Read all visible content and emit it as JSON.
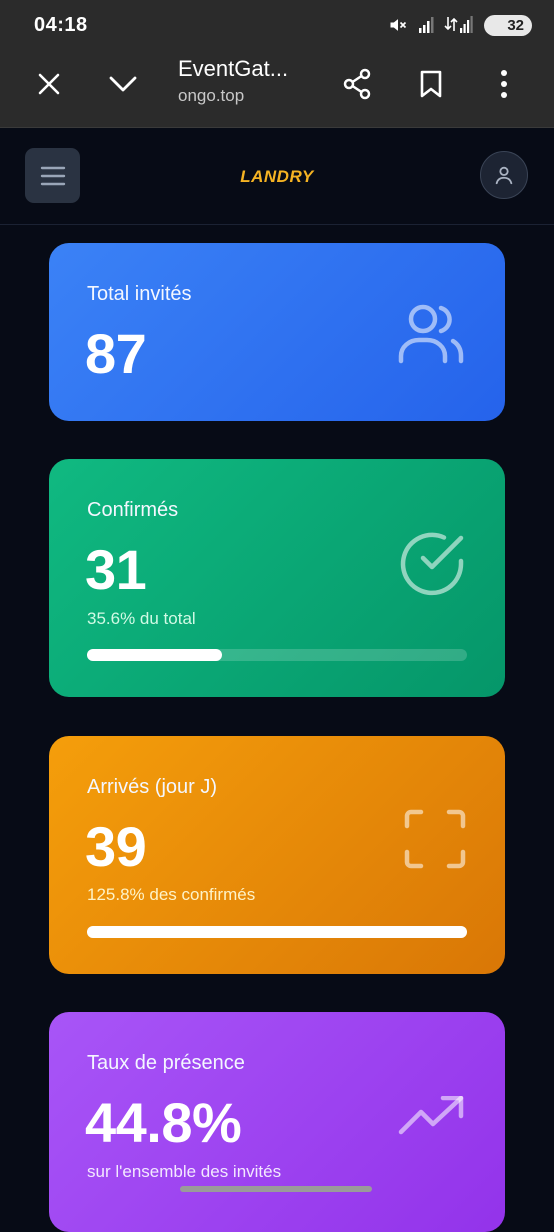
{
  "status_bar": {
    "time": "04:18",
    "battery": "32"
  },
  "browser": {
    "title": "EventGat...",
    "domain": "ongo.top"
  },
  "header": {
    "brand": "LANDRY"
  },
  "cards": [
    {
      "label": "Total invités",
      "value": "87",
      "icon": "users-icon",
      "color": "#3b82f6"
    },
    {
      "label": "Confirmés",
      "value": "31",
      "subtitle": "35.6% du total",
      "progress": 0.356,
      "icon": "check-circle-icon",
      "color": "#10b981"
    },
    {
      "label": "Arrivés (jour J)",
      "value": "39",
      "subtitle": "125.8% des confirmés",
      "progress": 1.0,
      "icon": "scan-icon",
      "color": "#f59e0b"
    },
    {
      "label": "Taux de présence",
      "value": "44.8%",
      "subtitle": "sur l'ensemble des invités",
      "icon": "trending-up-icon",
      "color": "#a855f7"
    }
  ]
}
